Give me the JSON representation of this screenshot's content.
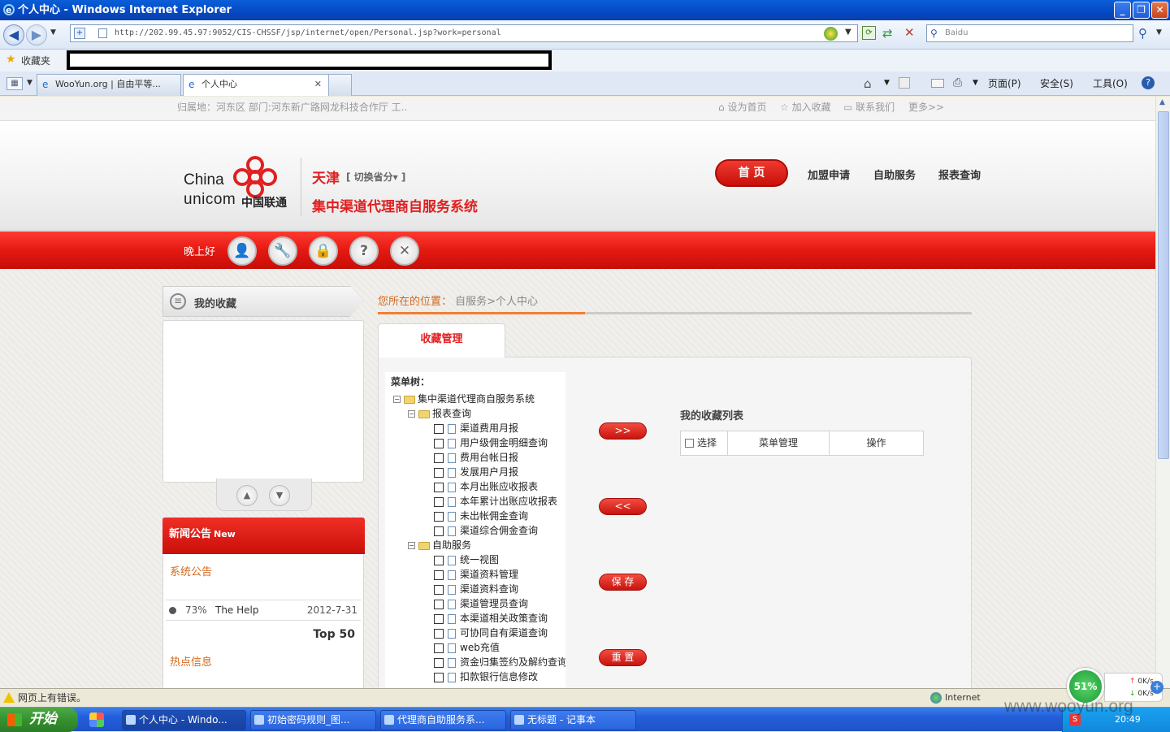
{
  "window": {
    "title": "个人中心 - Windows Internet Explorer",
    "buttons": [
      "_",
      "❐",
      "✕"
    ]
  },
  "address_bar": {
    "url": "http://202.99.45.97:9052/CIS-CHSSF/jsp/internet/open/Personal.jsp?work=personal",
    "search_placeholder": "Baidu"
  },
  "favorites_bar": {
    "label": "收藏夹"
  },
  "tabs": [
    {
      "label": "WooYun.org | 自由平等..."
    },
    {
      "label": "个人中心"
    }
  ],
  "tab_close": "✕",
  "toolbar": {
    "page": "页面(P)",
    "safety": "安全(S)",
    "tools": "工具(O)"
  },
  "site_top": {
    "location": "归属地：河东区 部门:河东新广路网龙科技合作厅 工..",
    "set_home": "设为首页",
    "add_fav": "加入收藏",
    "contact": "联系我们",
    "more": "更多>>"
  },
  "header": {
    "logo_china": "China",
    "logo_unicom": "unicom",
    "logo_cn": "中国联通",
    "city": "天津",
    "switch_province": "[ 切换省分▾ ]",
    "system_title": "集中渠道代理商自服务系统",
    "nav": {
      "home": "首 页",
      "join": "加盟申请",
      "self_service": "自助服务",
      "reports": "报表查询"
    }
  },
  "redbar": {
    "greeting": "晚上好",
    "icons": [
      "user-icon",
      "wrench-icon",
      "lock-icon",
      "help-icon",
      "close-icon"
    ],
    "icon_glyphs": [
      "👤",
      "🔧",
      "🔒",
      "?",
      "✕"
    ]
  },
  "favorites_panel": {
    "title": "我的收藏",
    "up": "▲",
    "down": "▼"
  },
  "news": {
    "title": "新闻公告",
    "badge": "New",
    "system_notice": "系统公告",
    "items": [
      {
        "percent": "73%",
        "title": "The Help",
        "date": "2012-7-31"
      }
    ],
    "top_label": "Top 50",
    "hot_info": "热点信息"
  },
  "breadcrumb": {
    "prefix": "您所在的位置：",
    "path": "自服务>个人中心"
  },
  "main": {
    "tab_label": "收藏管理",
    "menu_tree_label": "菜单树：",
    "tree": {
      "root": "集中渠道代理商自服务系统",
      "groups": [
        {
          "label": "报表查询",
          "items": [
            "渠道费用月报",
            "用户级佣金明细查询",
            "费用台帐日报",
            "发展用户月报",
            "本月出账应收报表",
            "本年累计出账应收报表",
            "未出帐佣金查询",
            "渠道综合佣金查询"
          ]
        },
        {
          "label": "自助服务",
          "items": [
            "统一视图",
            "渠道资料管理",
            "渠道资料查询",
            "渠道管理员查询",
            "本渠道相关政策查询",
            "可协同自有渠道查询",
            "web充值",
            "资金归集签约及解约查询",
            "扣款银行信息修改"
          ]
        }
      ]
    },
    "buttons": {
      "add": ">>",
      "remove": "<<",
      "save": "保 存",
      "reset": "重 置"
    },
    "my_list": {
      "title": "我的收藏列表",
      "columns": [
        "选择",
        "菜单管理",
        "操作"
      ]
    }
  },
  "status_bar": {
    "message": "网页上有错误。",
    "zone": "Internet"
  },
  "taskbar": {
    "start": "开始",
    "tasks": [
      {
        "label": "个人中心 - Windo..."
      },
      {
        "label": "初始密码规则_图..."
      },
      {
        "label": "代理商自助服务系..."
      },
      {
        "label": "无标题 - 记事本"
      }
    ],
    "clock": "20:49"
  },
  "speed_widget": {
    "percent": "51%",
    "up": "0K/s",
    "down": "0K/s"
  },
  "watermark": "www.wooyun.org"
}
